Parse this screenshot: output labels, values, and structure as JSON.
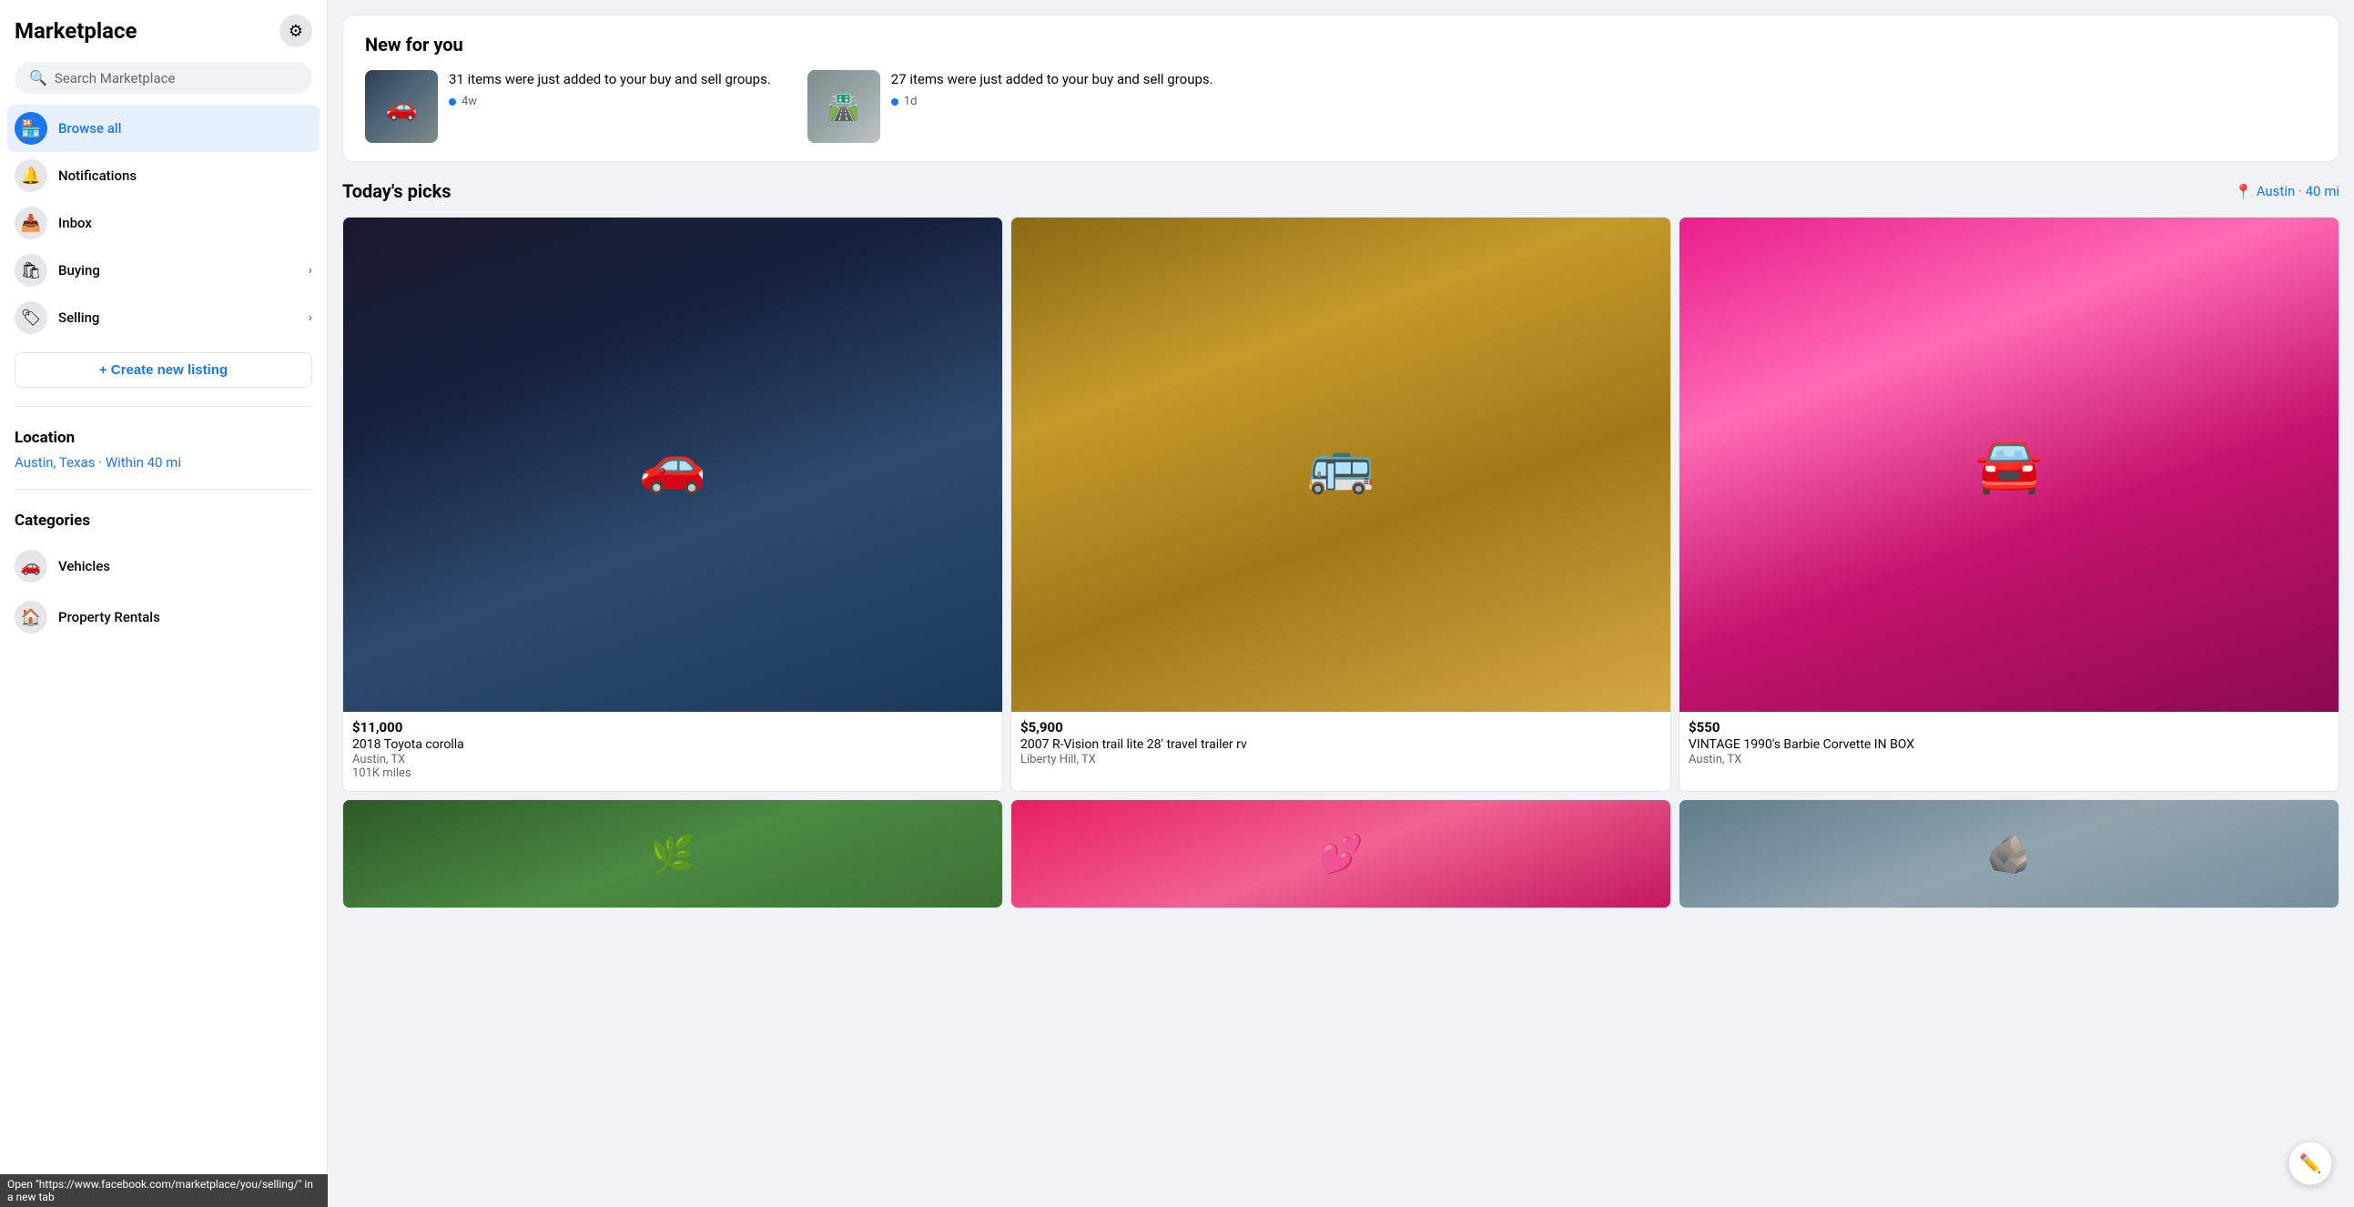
{
  "sidebar": {
    "title": "Marketplace",
    "gear_label": "⚙",
    "search_placeholder": "Search Marketplace",
    "nav_items": [
      {
        "id": "browse",
        "label": "Browse all",
        "icon": "🏪",
        "active": true,
        "has_chevron": false
      },
      {
        "id": "notifications",
        "label": "Notifications",
        "icon": "🔔",
        "active": false,
        "has_chevron": false
      },
      {
        "id": "inbox",
        "label": "Inbox",
        "icon": "📥",
        "active": false,
        "has_chevron": false
      },
      {
        "id": "buying",
        "label": "Buying",
        "icon": "🛍",
        "active": false,
        "has_chevron": true
      },
      {
        "id": "selling",
        "label": "Selling",
        "icon": "🏷",
        "active": false,
        "has_chevron": true
      }
    ],
    "create_listing_label": "+ Create new listing",
    "location_section_title": "Location",
    "location_text": "Austin, Texas · Within 40 mi",
    "categories_title": "Categories",
    "categories": [
      {
        "id": "vehicles",
        "label": "Vehicles",
        "icon": "🚗"
      },
      {
        "id": "property-rentals",
        "label": "Property Rentals",
        "icon": "🏠"
      }
    ],
    "status_bar_text": "Open \"https://www.facebook.com/marketplace/you/selling/\" in a new tab"
  },
  "main": {
    "new_for_you": {
      "title": "New for you",
      "notifications": [
        {
          "text": "31 items were just added to your buy and sell groups.",
          "time": "4w",
          "thumb_type": "car"
        },
        {
          "text": "27 items were just added to your buy and sell groups.",
          "time": "1d",
          "thumb_type": "road"
        }
      ]
    },
    "todays_picks": {
      "title": "Today's picks",
      "location": "Austin · 40 mi",
      "listings": [
        {
          "price": "$11,000",
          "title": "2018 Toyota corolla",
          "location": "Austin, TX",
          "extra": "101K miles",
          "img_type": "car"
        },
        {
          "price": "$5,900",
          "title": "2007 R-Vision trail lite 28' travel trailer rv",
          "location": "Liberty Hill, TX",
          "extra": "",
          "img_type": "rv"
        },
        {
          "price": "$550",
          "title": "VINTAGE 1990's Barbie Corvette IN BOX",
          "location": "Austin, TX",
          "extra": "",
          "img_type": "barbie"
        }
      ],
      "bottom_listings": [
        {
          "img_type": "trees"
        },
        {
          "img_type": "pink"
        },
        {
          "img_type": "gray"
        }
      ]
    }
  }
}
